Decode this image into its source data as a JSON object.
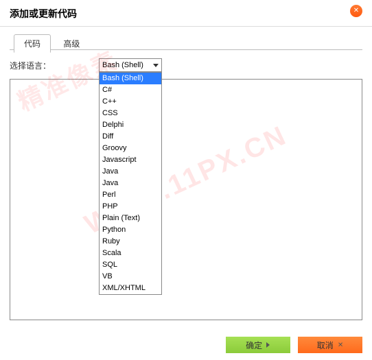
{
  "dialog": {
    "title": "添加或更新代码"
  },
  "tabs": [
    {
      "label": "代码",
      "active": true
    },
    {
      "label": "高级",
      "active": false
    }
  ],
  "form": {
    "language_label": "选择语言：",
    "language_selected": "Bash (Shell)",
    "language_options": [
      "Bash (Shell)",
      "C#",
      "C++",
      "CSS",
      "Delphi",
      "Diff",
      "Groovy",
      "Javascript",
      "Java",
      "Java",
      "Perl",
      "PHP",
      "Plain (Text)",
      "Python",
      "Ruby",
      "Scala",
      "SQL",
      "VB",
      "XML/XHTML"
    ],
    "code_value": ""
  },
  "footer": {
    "confirm_label": "确定",
    "cancel_label": "取消"
  },
  "watermark": {
    "text1": "WWW.11PX.CN",
    "text2": "精准像素"
  }
}
